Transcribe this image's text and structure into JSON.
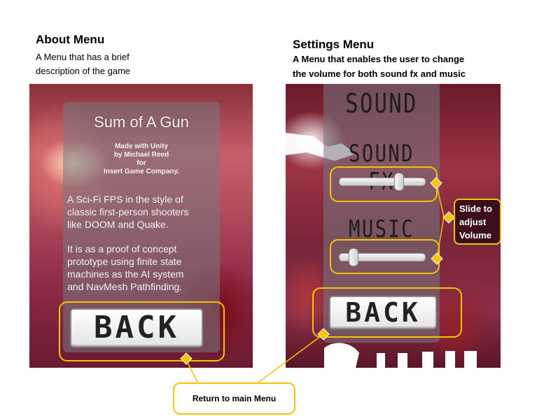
{
  "about": {
    "heading": "About Menu",
    "description_line1": "A Menu that has a brief",
    "description_line2": "description of the game",
    "game_title": "Sum of A Gun",
    "credits": [
      "Made with Unity",
      "by Michael Reed",
      "for",
      "Insert Game Company."
    ],
    "blurb_1": [
      "A Sci-Fi FPS in the style of",
      "classic first-person shooters",
      "like DOOM and Quake."
    ],
    "blurb_2": [
      "It is as a proof of concept",
      "prototype using finite state",
      "machines as the AI system",
      "and NavMesh Pathfinding."
    ],
    "back_label": "BACK"
  },
  "settings": {
    "heading": "Settings Menu",
    "description_line1": "A Menu that enables the user to change",
    "description_line2": "the volume for both sound fx and music",
    "sound_label": "SOUND",
    "sound_fx_label": "SOUND FX",
    "music_label": "MUSIC",
    "sound_fx_volume": 0.72,
    "music_volume": 0.12,
    "back_label": "BACK"
  },
  "callouts": {
    "slide_line1": "Slide to",
    "slide_line2": "adjust",
    "slide_line3": "Volume",
    "return": "Return to main Menu"
  },
  "colors": {
    "highlight": "#f4c400",
    "panel": "#787882"
  }
}
